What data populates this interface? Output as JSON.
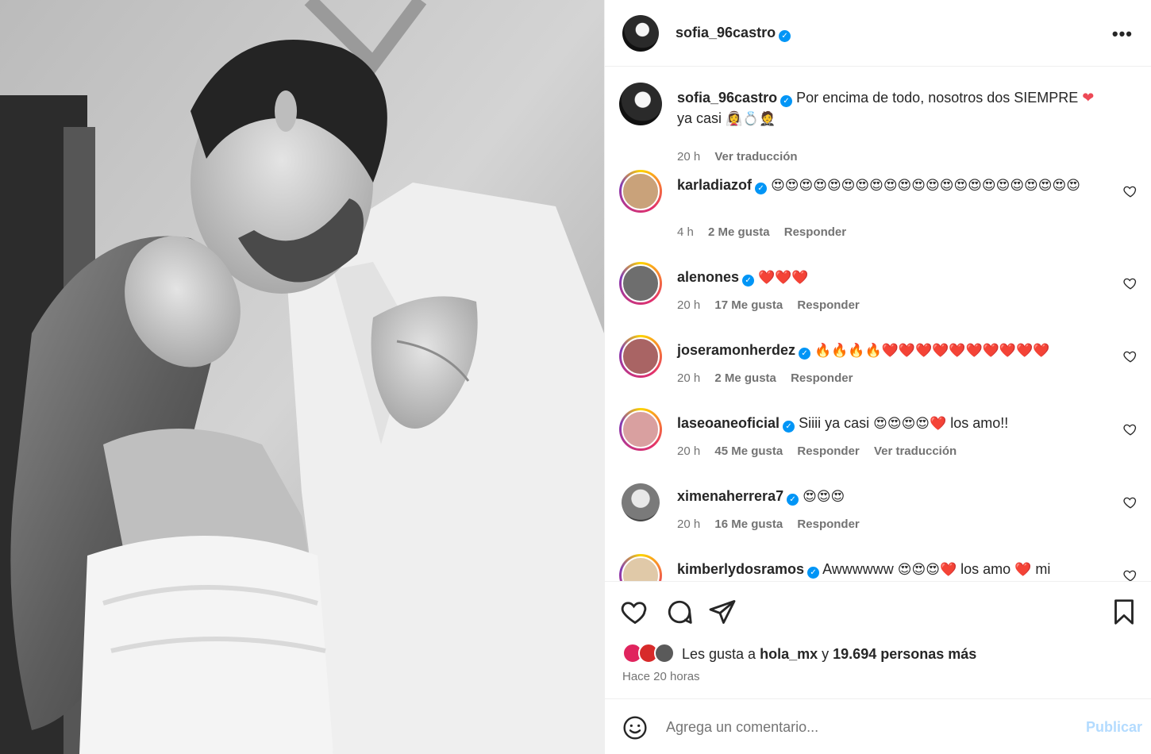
{
  "post": {
    "username": "sofia_96castro",
    "more_label": "•••"
  },
  "caption": {
    "username": "sofia_96castro",
    "text": "Por encima de todo, nosotros dos SIEMPRE",
    "line2": "ya casi",
    "line2_emoji": "👰‍♀️💍🤵",
    "time": "20 h",
    "translate": "Ver traducción"
  },
  "comments": [
    {
      "username": "karladiazof",
      "text": "",
      "emoji": "😍😍😍😍😍😍😍😍😍😍😍😍😍😍😍😍😍😍😍😍😍😍",
      "time": "4 h",
      "likes": "2 Me gusta",
      "reply": "Responder",
      "translate": ""
    },
    {
      "username": "alenones",
      "text": "",
      "emoji": "❤️❤️❤️",
      "time": "20 h",
      "likes": "17 Me gusta",
      "reply": "Responder",
      "translate": ""
    },
    {
      "username": "joseramonherdez",
      "text": "",
      "emoji": "🔥🔥🔥🔥❤️❤️❤️❤️❤️❤️❤️❤️❤️❤️",
      "time": "20 h",
      "likes": "2 Me gusta",
      "reply": "Responder",
      "translate": ""
    },
    {
      "username": "laseoaneoficial",
      "text": "Siiii ya casi",
      "emoji": "😍😍😍😍❤️",
      "text2": "los amo!!",
      "time": "20 h",
      "likes": "45 Me gusta",
      "reply": "Responder",
      "translate": "Ver traducción"
    },
    {
      "username": "ximenaherrera7",
      "text": "",
      "emoji": "😍😍😍",
      "time": "20 h",
      "likes": "16 Me gusta",
      "reply": "Responder",
      "translate": ""
    },
    {
      "username": "kimberlydosramos",
      "text": "Awwwwww",
      "emoji": "😍😍😍❤️",
      "text2": "los amo",
      "emoji2": "❤️",
      "text3": "mi",
      "time": "",
      "likes": "",
      "reply": "",
      "translate": ""
    }
  ],
  "likes": {
    "prefix": "Les gusta a",
    "user": "hola_mx",
    "connector": "y",
    "count": "19.694 personas más"
  },
  "time_ago": "Hace 20 horas",
  "compose": {
    "placeholder": "Agrega un comentario...",
    "post_label": "Publicar"
  },
  "colors": {
    "verified": "#0095f6",
    "like_red": "#ed4956",
    "post_disabled": "#b3dbff",
    "muted": "#737373"
  }
}
